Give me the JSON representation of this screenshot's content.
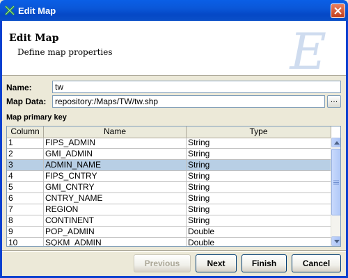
{
  "window": {
    "title": "Edit Map"
  },
  "header": {
    "title": "Edit Map",
    "subtitle": "Define map properties",
    "watermark": "E"
  },
  "form": {
    "name_label": "Name:",
    "name_value": "tw",
    "mapdata_label": "Map Data:",
    "mapdata_value": "repository:/Maps/TW/tw.shp",
    "browse_label": "..."
  },
  "table": {
    "section_label": "Map primary key",
    "columns": [
      "Column",
      "Name",
      "Type"
    ],
    "rows": [
      [
        "1",
        "FIPS_ADMIN",
        "String"
      ],
      [
        "2",
        "GMI_ADMIN",
        "String"
      ],
      [
        "3",
        "ADMIN_NAME",
        "String"
      ],
      [
        "4",
        "FIPS_CNTRY",
        "String"
      ],
      [
        "5",
        "GMI_CNTRY",
        "String"
      ],
      [
        "6",
        "CNTRY_NAME",
        "String"
      ],
      [
        "7",
        "REGION",
        "String"
      ],
      [
        "8",
        "CONTINENT",
        "String"
      ],
      [
        "9",
        "POP_ADMIN",
        "Double"
      ],
      [
        "10",
        "SQKM_ADMIN",
        "Double"
      ]
    ],
    "selected_row": 2
  },
  "buttons": {
    "previous": "Previous",
    "next": "Next",
    "finish": "Finish",
    "cancel": "Cancel"
  }
}
